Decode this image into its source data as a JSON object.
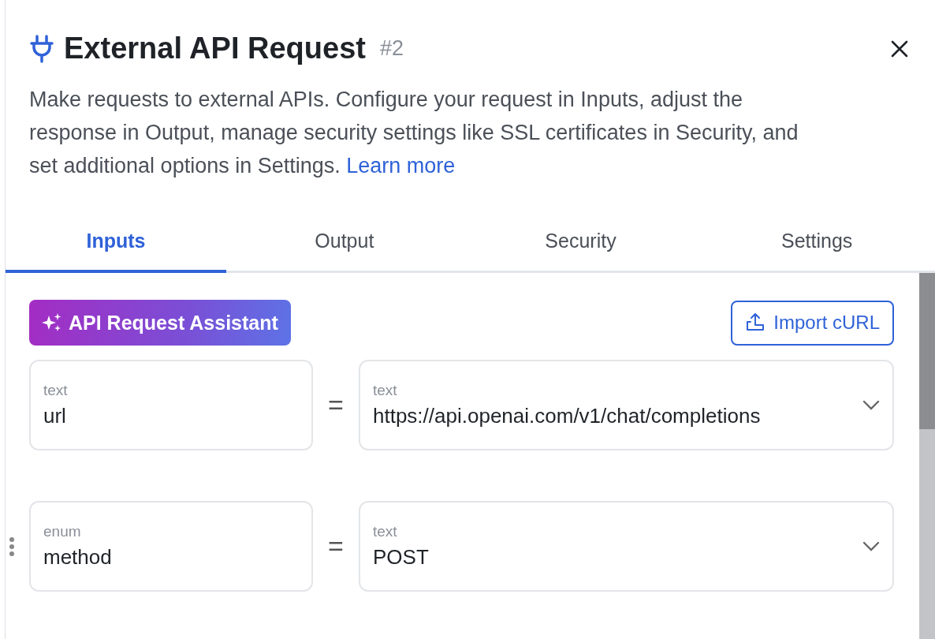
{
  "header": {
    "title": "External API Request",
    "badge": "#2"
  },
  "description": {
    "text": "Make requests to external APIs. Configure your request in Inputs, adjust the response in Output, manage security settings like SSL certificates in Security, and set additional options in Settings.",
    "link": "Learn more"
  },
  "tabs": [
    {
      "label": "Inputs",
      "selected": true
    },
    {
      "label": "Output",
      "selected": false
    },
    {
      "label": "Security",
      "selected": false
    },
    {
      "label": "Settings",
      "selected": false
    }
  ],
  "toolbar": {
    "assistant_button": "API Request Assistant",
    "import_button": "Import cURL"
  },
  "params": [
    {
      "key_type": "text",
      "key": "url",
      "operator": "=",
      "value_type": "text",
      "value": "https://api.openai.com/v1/chat/completions",
      "drag_handle": false
    },
    {
      "key_type": "enum",
      "key": "method",
      "operator": "=",
      "value_type": "text",
      "value": "POST",
      "drag_handle": true
    }
  ]
}
